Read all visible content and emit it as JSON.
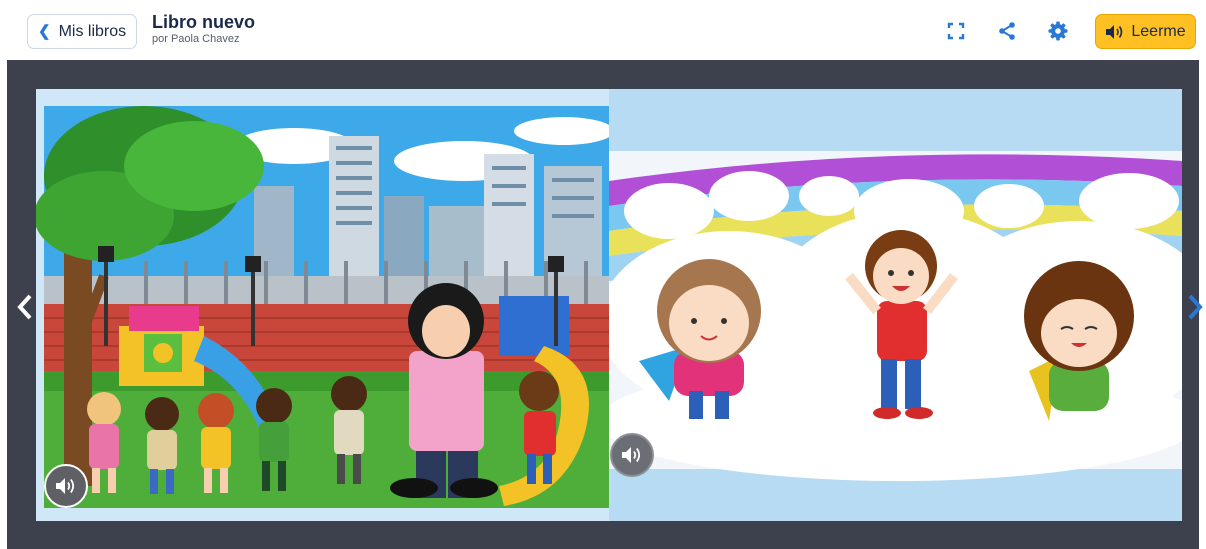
{
  "header": {
    "back_label": "Mis libros",
    "book_title": "Libro nuevo",
    "author": "por Paola Chavez",
    "read_label": "Leerme"
  },
  "colors": {
    "accent_blue": "#2a78d6",
    "read_button": "#ffc024",
    "stage_bg": "#3c414d"
  },
  "icons": {
    "back": "chevron-left-icon",
    "fullscreen": "fullscreen-icon",
    "share": "share-icon",
    "settings": "gear-icon",
    "read": "speaker-icon",
    "prev": "chevron-left-icon",
    "next": "chevron-right-icon",
    "audio": "speaker-icon"
  }
}
